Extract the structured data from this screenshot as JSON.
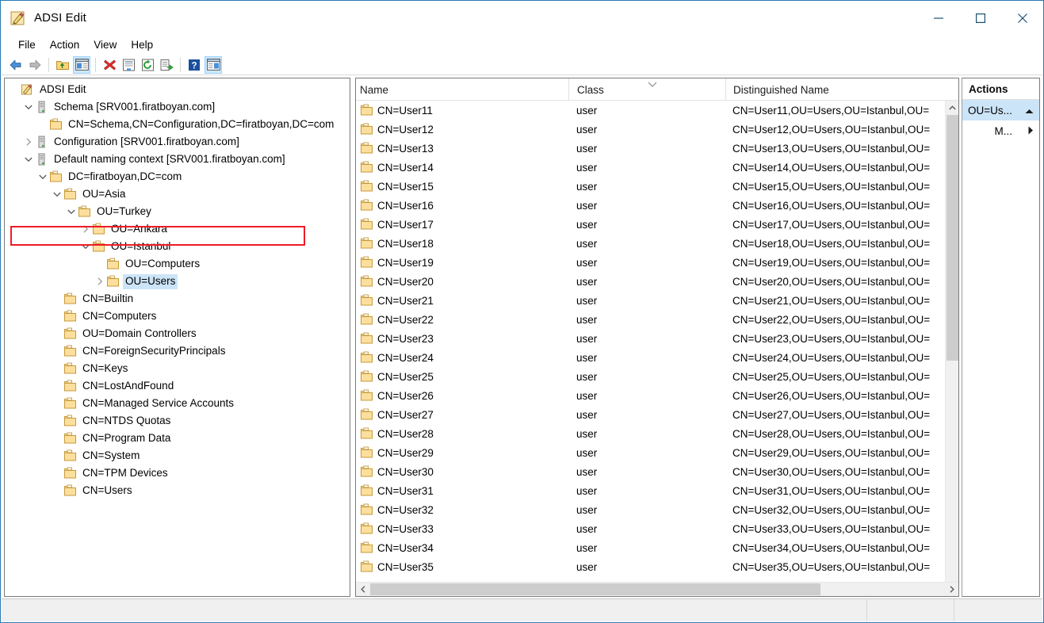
{
  "window": {
    "title": "ADSI Edit",
    "icon": "adsi-edit-icon",
    "minimize_label": "—",
    "maximize_label": "□",
    "close_label": "✕"
  },
  "menubar": {
    "items": [
      {
        "label": "File",
        "name": "menu-file"
      },
      {
        "label": "Action",
        "name": "menu-action"
      },
      {
        "label": "View",
        "name": "menu-view"
      },
      {
        "label": "Help",
        "name": "menu-help"
      }
    ]
  },
  "toolbar": {
    "buttons": [
      {
        "name": "back-button",
        "icon": "arrow-left-icon",
        "pressed": false
      },
      {
        "name": "forward-button",
        "icon": "arrow-right-icon",
        "pressed": false
      },
      {
        "name": "up-one-level-button",
        "icon": "folder-up-icon",
        "pressed": false
      },
      {
        "name": "show-hide-console-tree-button",
        "icon": "console-tree-icon",
        "pressed": true
      },
      {
        "name": "delete-button",
        "icon": "red-x-icon",
        "pressed": false
      },
      {
        "name": "properties-button",
        "icon": "properties-icon",
        "pressed": false
      },
      {
        "name": "refresh-button",
        "icon": "refresh-icon",
        "pressed": false
      },
      {
        "name": "export-list-button",
        "icon": "export-list-icon",
        "pressed": false
      },
      {
        "name": "help-button",
        "icon": "question-mark-icon",
        "pressed": false
      },
      {
        "name": "show-hide-action-pane-button",
        "icon": "action-pane-icon",
        "pressed": true
      }
    ]
  },
  "tree": {
    "nodes": [
      {
        "label": "ADSI Edit",
        "indent": 0,
        "icon": "adsi-edit-icon",
        "chevron": "none",
        "selected": false,
        "name": "tree-node-adsi-edit"
      },
      {
        "label": "Schema [SRV001.firatboyan.com]",
        "indent": 1,
        "icon": "server-icon",
        "chevron": "down",
        "selected": false,
        "name": "tree-node-schema"
      },
      {
        "label": "CN=Schema,CN=Configuration,DC=firatboyan,DC=com",
        "indent": 2,
        "icon": "folder-icon",
        "chevron": "none",
        "selected": false,
        "name": "tree-node-cn-schema"
      },
      {
        "label": "Configuration [SRV001.firatboyan.com]",
        "indent": 1,
        "icon": "server-icon",
        "chevron": "right",
        "selected": false,
        "name": "tree-node-configuration"
      },
      {
        "label": "Default naming context [SRV001.firatboyan.com]",
        "indent": 1,
        "icon": "server-icon",
        "chevron": "down",
        "selected": false,
        "name": "tree-node-default-naming-context"
      },
      {
        "label": "DC=firatboyan,DC=com",
        "indent": 2,
        "icon": "folder-icon",
        "chevron": "down",
        "selected": false,
        "name": "tree-node-dc-firatboyan"
      },
      {
        "label": "OU=Asia",
        "indent": 3,
        "icon": "folder-icon",
        "chevron": "down",
        "selected": false,
        "name": "tree-node-ou-asia"
      },
      {
        "label": "OU=Turkey",
        "indent": 4,
        "icon": "folder-icon",
        "chevron": "down",
        "selected": false,
        "name": "tree-node-ou-turkey"
      },
      {
        "label": "OU=Ankara",
        "indent": 5,
        "icon": "folder-icon",
        "chevron": "right",
        "selected": false,
        "name": "tree-node-ou-ankara"
      },
      {
        "label": "OU=Istanbul",
        "indent": 5,
        "icon": "folder-icon",
        "chevron": "down",
        "selected": false,
        "name": "tree-node-ou-istanbul"
      },
      {
        "label": "OU=Computers",
        "indent": 6,
        "icon": "folder-icon",
        "chevron": "none",
        "selected": false,
        "name": "tree-node-ou-computers"
      },
      {
        "label": "OU=Users",
        "indent": 6,
        "icon": "folder-icon",
        "chevron": "right",
        "selected": true,
        "name": "tree-node-ou-users"
      },
      {
        "label": "CN=Builtin",
        "indent": 3,
        "icon": "folder-icon",
        "chevron": "none",
        "selected": false,
        "name": "tree-node-cn-builtin"
      },
      {
        "label": "CN=Computers",
        "indent": 3,
        "icon": "folder-icon",
        "chevron": "none",
        "selected": false,
        "name": "tree-node-cn-computers"
      },
      {
        "label": "OU=Domain Controllers",
        "indent": 3,
        "icon": "folder-icon",
        "chevron": "none",
        "selected": false,
        "name": "tree-node-ou-domain-controllers"
      },
      {
        "label": "CN=ForeignSecurityPrincipals",
        "indent": 3,
        "icon": "folder-icon",
        "chevron": "none",
        "selected": false,
        "name": "tree-node-cn-foreignsecurityprincipals"
      },
      {
        "label": "CN=Keys",
        "indent": 3,
        "icon": "folder-icon",
        "chevron": "none",
        "selected": false,
        "name": "tree-node-cn-keys"
      },
      {
        "label": "CN=LostAndFound",
        "indent": 3,
        "icon": "folder-icon",
        "chevron": "none",
        "selected": false,
        "name": "tree-node-cn-lostandfound"
      },
      {
        "label": "CN=Managed Service Accounts",
        "indent": 3,
        "icon": "folder-icon",
        "chevron": "none",
        "selected": false,
        "name": "tree-node-cn-managed-service-accounts"
      },
      {
        "label": "CN=NTDS Quotas",
        "indent": 3,
        "icon": "folder-icon",
        "chevron": "none",
        "selected": false,
        "name": "tree-node-cn-ntds-quotas"
      },
      {
        "label": "CN=Program Data",
        "indent": 3,
        "icon": "folder-icon",
        "chevron": "none",
        "selected": false,
        "name": "tree-node-cn-program-data"
      },
      {
        "label": "CN=System",
        "indent": 3,
        "icon": "folder-icon",
        "chevron": "none",
        "selected": false,
        "name": "tree-node-cn-system"
      },
      {
        "label": "CN=TPM Devices",
        "indent": 3,
        "icon": "folder-icon",
        "chevron": "none",
        "selected": false,
        "name": "tree-node-cn-tpm-devices"
      },
      {
        "label": "CN=Users",
        "indent": 3,
        "icon": "folder-icon",
        "chevron": "none",
        "selected": false,
        "name": "tree-node-cn-users"
      }
    ],
    "highlight": {
      "target_label": "Default naming context [SRV001.firatboyan.com]",
      "color": "#ee1c25"
    }
  },
  "list": {
    "columns": [
      {
        "label": "Name",
        "name": "column-header-name"
      },
      {
        "label": "Class",
        "name": "column-header-class"
      },
      {
        "label": "Distinguished Name",
        "name": "column-header-distinguished-name"
      }
    ],
    "sort_indicator": "chevron-down-icon",
    "rows": [
      {
        "name": "CN=User11",
        "class": "user",
        "dn": "CN=User11,OU=Users,OU=Istanbul,OU="
      },
      {
        "name": "CN=User12",
        "class": "user",
        "dn": "CN=User12,OU=Users,OU=Istanbul,OU="
      },
      {
        "name": "CN=User13",
        "class": "user",
        "dn": "CN=User13,OU=Users,OU=Istanbul,OU="
      },
      {
        "name": "CN=User14",
        "class": "user",
        "dn": "CN=User14,OU=Users,OU=Istanbul,OU="
      },
      {
        "name": "CN=User15",
        "class": "user",
        "dn": "CN=User15,OU=Users,OU=Istanbul,OU="
      },
      {
        "name": "CN=User16",
        "class": "user",
        "dn": "CN=User16,OU=Users,OU=Istanbul,OU="
      },
      {
        "name": "CN=User17",
        "class": "user",
        "dn": "CN=User17,OU=Users,OU=Istanbul,OU="
      },
      {
        "name": "CN=User18",
        "class": "user",
        "dn": "CN=User18,OU=Users,OU=Istanbul,OU="
      },
      {
        "name": "CN=User19",
        "class": "user",
        "dn": "CN=User19,OU=Users,OU=Istanbul,OU="
      },
      {
        "name": "CN=User20",
        "class": "user",
        "dn": "CN=User20,OU=Users,OU=Istanbul,OU="
      },
      {
        "name": "CN=User21",
        "class": "user",
        "dn": "CN=User21,OU=Users,OU=Istanbul,OU="
      },
      {
        "name": "CN=User22",
        "class": "user",
        "dn": "CN=User22,OU=Users,OU=Istanbul,OU="
      },
      {
        "name": "CN=User23",
        "class": "user",
        "dn": "CN=User23,OU=Users,OU=Istanbul,OU="
      },
      {
        "name": "CN=User24",
        "class": "user",
        "dn": "CN=User24,OU=Users,OU=Istanbul,OU="
      },
      {
        "name": "CN=User25",
        "class": "user",
        "dn": "CN=User25,OU=Users,OU=Istanbul,OU="
      },
      {
        "name": "CN=User26",
        "class": "user",
        "dn": "CN=User26,OU=Users,OU=Istanbul,OU="
      },
      {
        "name": "CN=User27",
        "class": "user",
        "dn": "CN=User27,OU=Users,OU=Istanbul,OU="
      },
      {
        "name": "CN=User28",
        "class": "user",
        "dn": "CN=User28,OU=Users,OU=Istanbul,OU="
      },
      {
        "name": "CN=User29",
        "class": "user",
        "dn": "CN=User29,OU=Users,OU=Istanbul,OU="
      },
      {
        "name": "CN=User30",
        "class": "user",
        "dn": "CN=User30,OU=Users,OU=Istanbul,OU="
      },
      {
        "name": "CN=User31",
        "class": "user",
        "dn": "CN=User31,OU=Users,OU=Istanbul,OU="
      },
      {
        "name": "CN=User32",
        "class": "user",
        "dn": "CN=User32,OU=Users,OU=Istanbul,OU="
      },
      {
        "name": "CN=User33",
        "class": "user",
        "dn": "CN=User33,OU=Users,OU=Istanbul,OU="
      },
      {
        "name": "CN=User34",
        "class": "user",
        "dn": "CN=User34,OU=Users,OU=Istanbul,OU="
      },
      {
        "name": "CN=User35",
        "class": "user",
        "dn": "CN=User35,OU=Users,OU=Istanbul,OU="
      }
    ]
  },
  "actions": {
    "title": "Actions",
    "group_label": "OU=Us...",
    "group_collapse_icon": "chevron-up-icon",
    "items": [
      {
        "label": "M...",
        "icon": "submenu-arrow-icon",
        "name": "action-item-more-actions"
      }
    ]
  },
  "statusbar": {
    "cells": [
      "",
      "",
      ""
    ]
  },
  "colors": {
    "window_border": "#2a7ab0",
    "selection": "#cce4f7",
    "highlight_red": "#ee1c25",
    "folder_yellow": "#ffd98a",
    "scrollbar_thumb": "#cdcdcd"
  }
}
